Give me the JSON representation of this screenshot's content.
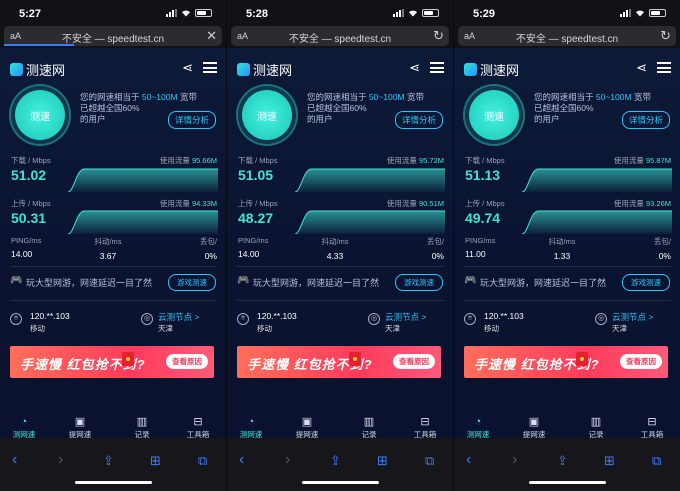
{
  "phones": [
    {
      "time": "5:27",
      "address": {
        "aa": "aA",
        "url": "不安全 — speedtest.cn",
        "control": "✕"
      },
      "logo": "测速网",
      "gauge_label": "测速",
      "summary": {
        "pre": "您的网速相当于",
        "range": "50~100M",
        "post": "宽带",
        "beat_pre": "已超越全国",
        "beat": "60%",
        "beat_post": "的用户"
      },
      "detail_button": "详情分析",
      "download": {
        "label": "下载 / Mbps",
        "value": "51.02",
        "usage_label": "使用流量",
        "usage": "95.66M"
      },
      "upload": {
        "label": "上传 / Mbps",
        "value": "50.31",
        "usage_label": "使用流量",
        "usage": "94.33M"
      },
      "ping": {
        "label": "PING/ms",
        "value": "14.00"
      },
      "jitter": {
        "label": "抖动/ms",
        "value": "3.67"
      },
      "loss": {
        "label": "丢包/",
        "value": "0%"
      },
      "game": {
        "text": "玩大型网游，网速延迟一目了然",
        "button": "游戏测速"
      },
      "node": {
        "ip": "120.**.103",
        "isp": "移动",
        "cloud": "云测节点 >",
        "city": "天津"
      },
      "banner": {
        "text": "手速慢 红包抢不到?",
        "button": "查看原因"
      },
      "nav": [
        "测网速",
        "提网速",
        "记录",
        "工具箱"
      ]
    },
    {
      "time": "5:28",
      "address": {
        "aa": "aA",
        "url": "不安全 — speedtest.cn",
        "control": "↻"
      },
      "logo": "测速网",
      "gauge_label": "测速",
      "summary": {
        "pre": "您的网速相当于",
        "range": "50~100M",
        "post": "宽带",
        "beat_pre": "已超越全国",
        "beat": "60%",
        "beat_post": "的用户"
      },
      "detail_button": "详情分析",
      "download": {
        "label": "下载 / Mbps",
        "value": "51.05",
        "usage_label": "使用流量",
        "usage": "95.72M"
      },
      "upload": {
        "label": "上传 / Mbps",
        "value": "48.27",
        "usage_label": "使用流量",
        "usage": "90.51M"
      },
      "ping": {
        "label": "PING/ms",
        "value": "14.00"
      },
      "jitter": {
        "label": "抖动/ms",
        "value": "4.33"
      },
      "loss": {
        "label": "丢包/",
        "value": "0%"
      },
      "game": {
        "text": "玩大型网游，网速延迟一目了然",
        "button": "游戏测速"
      },
      "node": {
        "ip": "120.**.103",
        "isp": "移动",
        "cloud": "云测节点 >",
        "city": "天津"
      },
      "banner": {
        "text": "手速慢 红包抢不到?",
        "button": "查看原因"
      },
      "nav": [
        "测网速",
        "提网速",
        "记录",
        "工具箱"
      ]
    },
    {
      "time": "5:29",
      "address": {
        "aa": "aA",
        "url": "不安全 — speedtest.cn",
        "control": "↻"
      },
      "logo": "测速网",
      "gauge_label": "测速",
      "summary": {
        "pre": "您的网速相当于",
        "range": "50~100M",
        "post": "宽带",
        "beat_pre": "已超越全国",
        "beat": "60%",
        "beat_post": "的用户"
      },
      "detail_button": "详情分析",
      "download": {
        "label": "下载 / Mbps",
        "value": "51.13",
        "usage_label": "使用流量",
        "usage": "95.87M"
      },
      "upload": {
        "label": "上传 / Mbps",
        "value": "49.74",
        "usage_label": "使用流量",
        "usage": "93.26M"
      },
      "ping": {
        "label": "PING/ms",
        "value": "11.00"
      },
      "jitter": {
        "label": "抖动/ms",
        "value": "1.33"
      },
      "loss": {
        "label": "丢包/",
        "value": "0%"
      },
      "game": {
        "text": "玩大型网游，网速延迟一目了然",
        "button": "游戏测速"
      },
      "node": {
        "ip": "120.**.103",
        "isp": "移动",
        "cloud": "云测节点 >",
        "city": "天津"
      },
      "banner": {
        "text": "手速慢 红包抢不到?",
        "button": "查看原因"
      },
      "nav": [
        "测网速",
        "提网速",
        "记录",
        "工具箱"
      ]
    }
  ],
  "colors": {
    "accent": "#3ee4d6",
    "link": "#27c8ff",
    "banner": "#ff3b5c",
    "safari_blue": "#3b7cff"
  }
}
